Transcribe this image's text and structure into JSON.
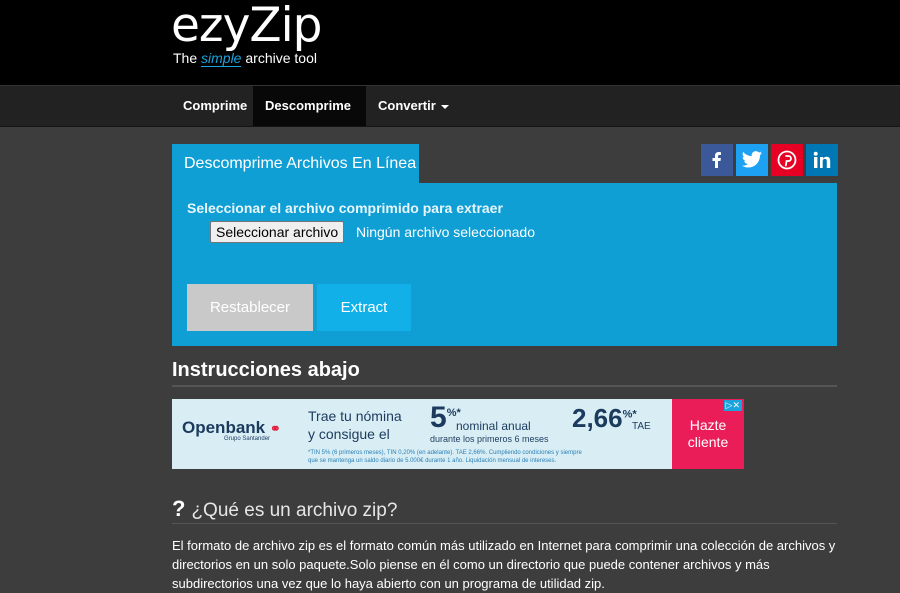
{
  "brand": {
    "name": "ezyZip",
    "name_part1": "ezy",
    "name_part2": "Zip",
    "tagline_pre": "The ",
    "tagline_em": "simple",
    "tagline_post": " archive tool"
  },
  "nav": [
    {
      "label": "Comprime",
      "dropdown": false
    },
    {
      "label": "Descomprime",
      "dropdown": true,
      "active": true
    },
    {
      "label": "Convertir",
      "dropdown": true
    }
  ],
  "tool": {
    "tab_title": "Descomprime Archivos En Línea",
    "select_label": "Seleccionar el archivo comprimido para extraer",
    "file_button": "Seleccionar archivo",
    "file_status": "Ningún archivo seleccionado",
    "reset_button": "Restablecer",
    "extract_button": "Extract"
  },
  "social": [
    {
      "name": "facebook",
      "glyph": "f",
      "color": "#3b5998"
    },
    {
      "name": "twitter",
      "glyph": "t",
      "color": "#1da1f2"
    },
    {
      "name": "pinterest",
      "glyph": "p",
      "color": "#e60023"
    },
    {
      "name": "linkedin",
      "glyph": "in",
      "color": "#0077b5"
    }
  ],
  "instructions_heading": "Instrucciones abajo",
  "ad": {
    "brand": "Openbank",
    "brand_sub": "Grupo Santander",
    "line1": "Trae tu nómina",
    "line2": "y consigue el",
    "rate_big": "5",
    "rate_sup": "%*",
    "rate_text": "nominal anual",
    "rate_sub": "durante los primeros 6 meses",
    "tae_big": "2,66",
    "tae_sup": "%*",
    "tae_label": "TAE",
    "fine_print1": "*TIN 5% (6 primeros meses), TIN 0,20% (en adelante). TAE 2,66%. Cumpliendo condiciones y siempre",
    "fine_print2": "que se mantenga un saldo diario de 5.000€ durante 1 año. Liquidación mensual de intereses.",
    "cta_line1": "Hazte",
    "cta_line2": "cliente"
  },
  "faq": {
    "title": "¿Qué es un archivo zip?",
    "text": "El formato de archivo zip es el formato común más utilizado en Internet para comprimir una colección de archivos y directorios en un solo paquete.Solo piense en él como un directorio que puede contener archivos y más subdirectorios una vez que lo haya abierto con un programa de utilidad zip."
  }
}
